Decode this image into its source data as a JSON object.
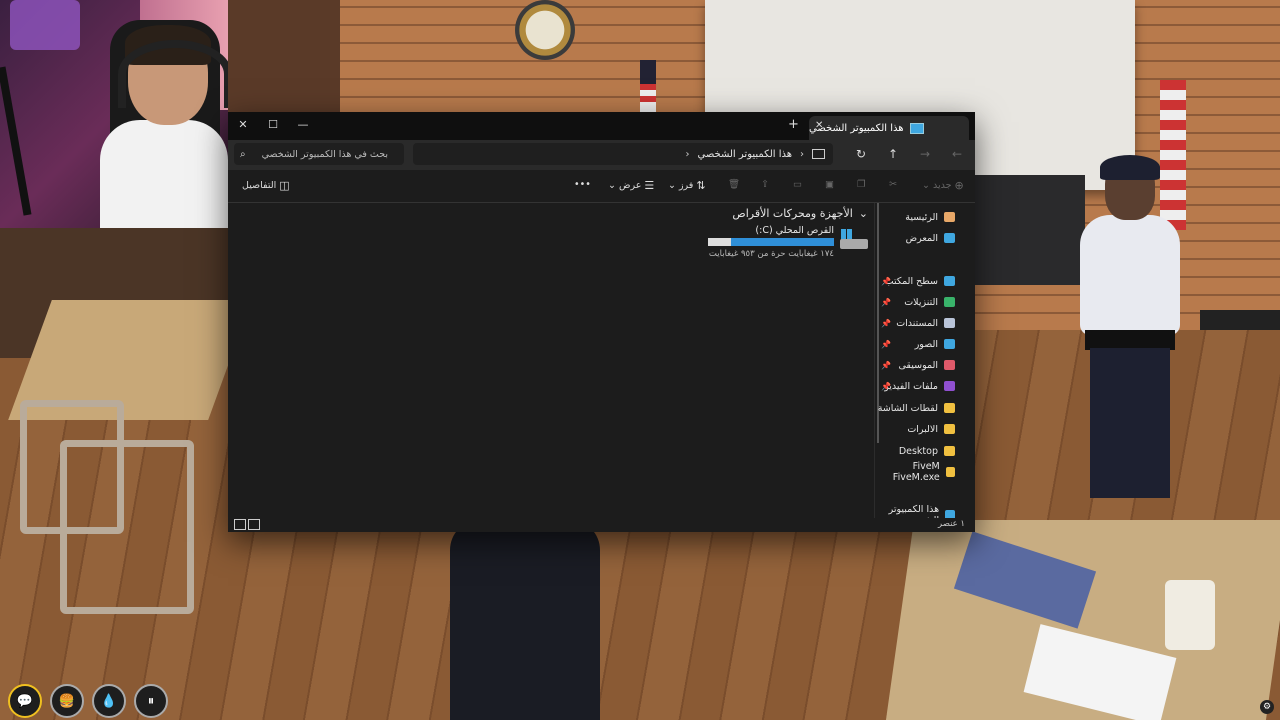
{
  "explorer": {
    "tab": {
      "title": "هذا الكمبيوتر الشخصي",
      "close": "✕",
      "new": "+"
    },
    "window_controls": {
      "minimize": "—",
      "maximize": "☐",
      "close": "✕"
    },
    "nav": {
      "back": "←",
      "forward": "→",
      "up": "↑",
      "refresh": "↻"
    },
    "address": {
      "path": "هذا الكمبيوتر الشخصي",
      "chevron": "›"
    },
    "search": {
      "placeholder": "بحث في هذا الكمبيوتر الشخصي"
    },
    "toolbar": {
      "new": "جديد",
      "sort": "فرز",
      "view": "عرض",
      "more": "•••",
      "details": "التفاصيل"
    },
    "sidebar": [
      {
        "label": "الرئيسية",
        "icon": "home-icon",
        "color": "#e8a868",
        "pinned": false
      },
      {
        "label": "المعرض",
        "icon": "gallery-icon",
        "color": "#3fa7e0",
        "pinned": false
      },
      {
        "label": "سطح المكتب",
        "icon": "desktop-icon",
        "color": "#3fa7e0",
        "pinned": true
      },
      {
        "label": "التنزيلات",
        "icon": "download-icon",
        "color": "#39b36a",
        "pinned": true
      },
      {
        "label": "المستندات",
        "icon": "document-icon",
        "color": "#b9c4d8",
        "pinned": true
      },
      {
        "label": "الصور",
        "icon": "pictures-icon",
        "color": "#3fa7e0",
        "pinned": true
      },
      {
        "label": "الموسيقى",
        "icon": "music-icon",
        "color": "#e05a6a",
        "pinned": true
      },
      {
        "label": "ملفات الفيديو",
        "icon": "video-icon",
        "color": "#9050d0",
        "pinned": true
      },
      {
        "label": "لقطات الشاشة",
        "icon": "folder-icon",
        "color": "#f0c040",
        "pinned": false
      },
      {
        "label": "الالبرات",
        "icon": "folder-icon",
        "color": "#f0c040",
        "pinned": false
      },
      {
        "label": "Desktop",
        "icon": "folder-icon",
        "color": "#f0c040",
        "pinned": false
      },
      {
        "label": "FiveM FiveM.exe",
        "icon": "folder-icon",
        "color": "#f0c040",
        "pinned": false
      },
      {
        "label": "هذا الكمبيوتر الش",
        "icon": "this-pc-icon",
        "color": "#3fa7e0",
        "pinned": false
      }
    ],
    "content": {
      "group": "الأجهزة ومحركات الأقراص",
      "drive": {
        "name": "القرص المحلي (C:)",
        "free_text": "١٧٤ غيغابايت حرة من ٩٥٣ غيغابايت",
        "used_fraction": 0.82
      }
    },
    "status": {
      "count": "١ عنصر"
    }
  },
  "hud": [
    "💬",
    "🍔",
    "💧",
    "⏸"
  ],
  "colors": {
    "accent": "#2f8fd8",
    "window_bg": "#1c1c1c",
    "titlebar": "#0f0f0f"
  }
}
